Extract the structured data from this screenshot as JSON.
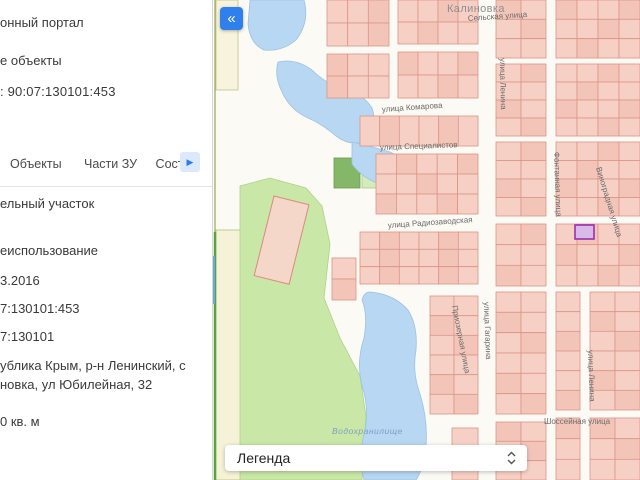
{
  "panel": {
    "portal_title": "онный портал",
    "objects_link": "е объекты",
    "object_heading": ": 90:07:130101:453",
    "tabs": {
      "objects": "Объекты",
      "parts": "Части ЗУ",
      "composition": "Соста"
    },
    "fields": {
      "object_type": "ельный участок",
      "land_use": "еиспользование",
      "date": "3.2016",
      "cadastral_number": "7:130101:453",
      "cadastral_quarter": "7:130101",
      "address_line1": "ублика Крым, р-н Ленинский, с",
      "address_line2": "новка, ул Юбилейная, 32",
      "area": "0 кв. м"
    }
  },
  "map": {
    "town_label": "Калиновка",
    "water_label": "Водохранилище",
    "streets": {
      "selskaya": "Сельская улица",
      "lenina": "улица Ленина",
      "komarova": "улица Комарова",
      "specialistov": "улица Специалистов",
      "radiozavodskaya": "улица Радиозаводская",
      "vinogradnaya": "Виноградная улица",
      "fontannaya": "Фонтанная улица",
      "gagarina": "улица Гагарина",
      "priozernaya": "Приозерная улица",
      "lenina2": "улица Ленина",
      "shosseynaya": "Шоссейная улица"
    },
    "legend_label": "Легенда",
    "selected_parcel": "90:07:130101:453"
  },
  "icons": {
    "collapse": "«",
    "tab_scroll": "▶"
  },
  "colors": {
    "accent_blue": "#2f80ed",
    "link_blue": "#1f78d1",
    "parcel_fill": "#f7d0c5",
    "parcel_stroke": "#dc9488",
    "selected_fill": "#d8b9e8",
    "selected_stroke": "#9b2fae",
    "water": "#b7d7f2",
    "green": "#c9e7a6"
  }
}
